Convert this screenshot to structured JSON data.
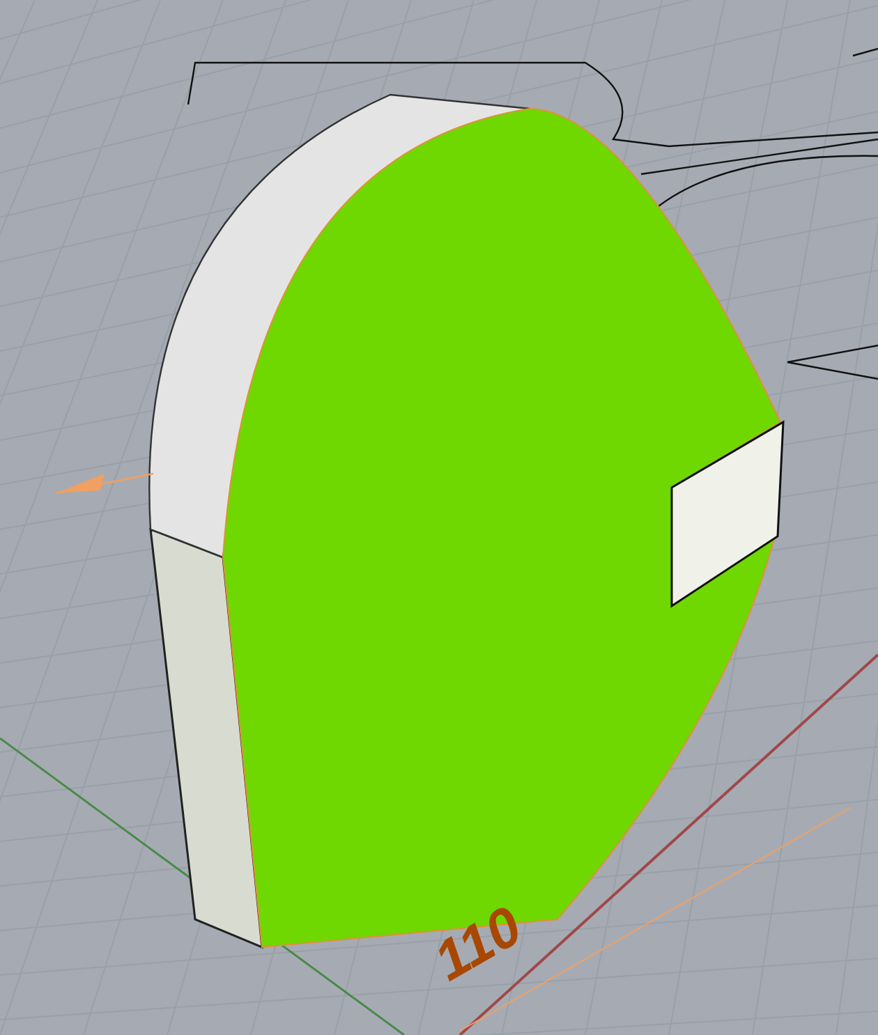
{
  "viewport": {
    "dimension_label": "110"
  }
}
